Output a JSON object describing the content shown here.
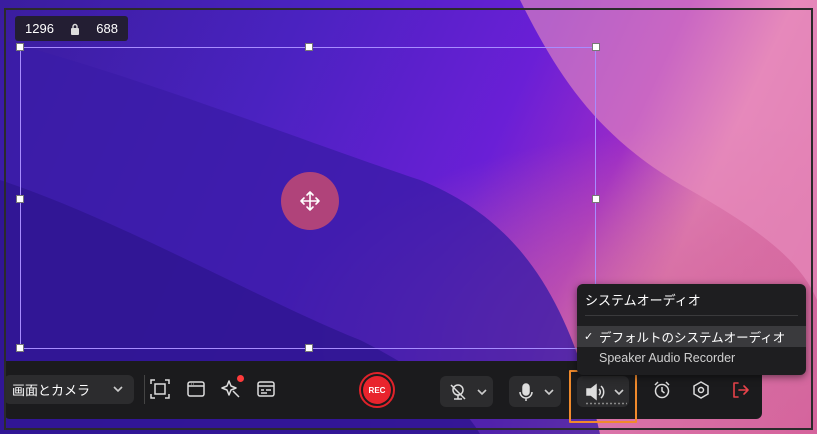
{
  "selection": {
    "width_label": "1296",
    "height_label": "688"
  },
  "toolbar": {
    "mode_label": "画面とカメラ",
    "rec_label": "REC"
  },
  "audio_menu": {
    "title": "システムオーディオ",
    "items": [
      {
        "label": "デフォルトのシステムオーディオ",
        "checked": true
      },
      {
        "label": "Speaker Audio Recorder",
        "checked": false
      }
    ]
  },
  "colors": {
    "accent": "#f08a2c",
    "rec": "#e8242d",
    "selection_border": "#a88cff",
    "exit": "#e8434a"
  },
  "icons": [
    "lock-icon",
    "move-icon",
    "fullscreen-icon",
    "window-icon",
    "magic-icon",
    "caption-icon",
    "webcam-off-icon",
    "microphone-icon",
    "speaker-icon",
    "alarm-icon",
    "settings-icon",
    "exit-icon"
  ]
}
